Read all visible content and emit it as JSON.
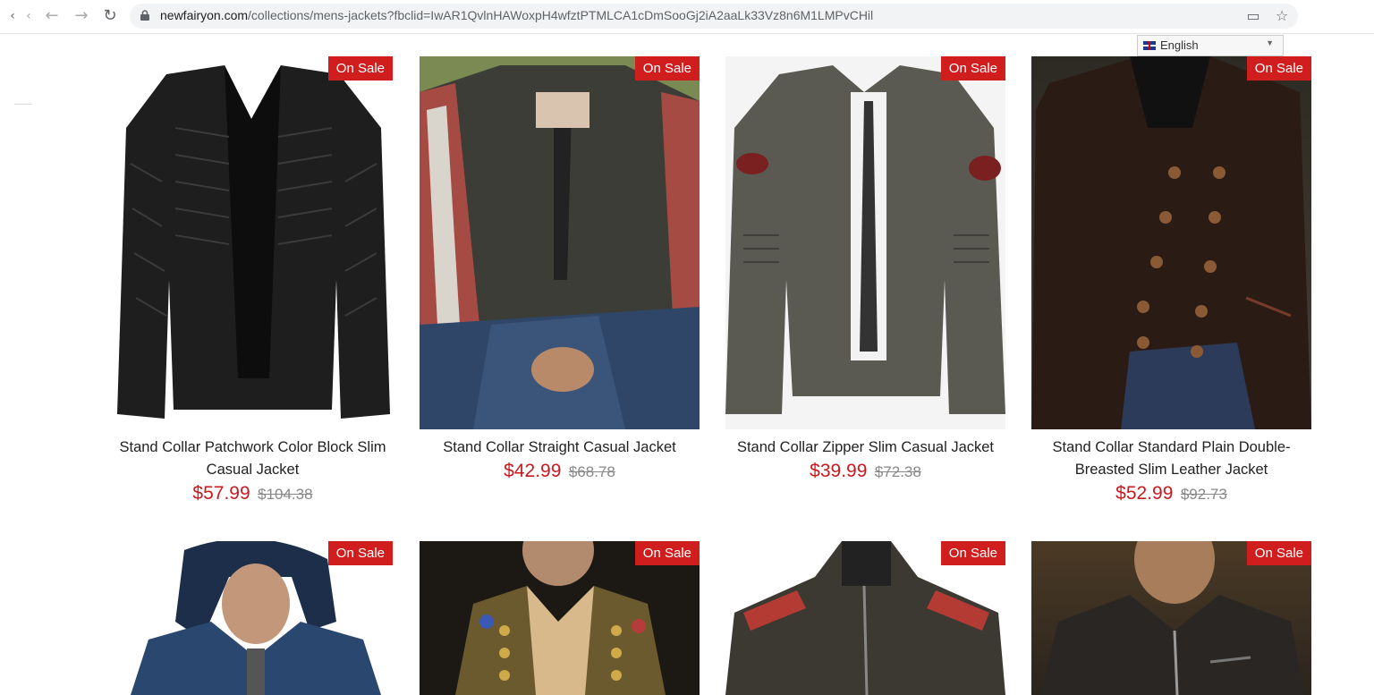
{
  "browser": {
    "url_host": "newfairyon.com",
    "url_path": "/collections/mens-jackets?fbclid=IwAR1QvlnHAWoxpH4wfztPTMLCA1cDmSooGj2iA2aaLk33Vz8n6M1LMPvCHil"
  },
  "language_selector": {
    "value": "English"
  },
  "colors": {
    "sale_badge": "#d01d1d",
    "price": "#c8191f"
  },
  "products": [
    {
      "title": "Stand Collar Patchwork Color Block Slim Casual Jacket",
      "price": "$57.99",
      "old_price": "$104.38",
      "badge": "On Sale"
    },
    {
      "title": "Stand Collar Straight Casual Jacket",
      "price": "$42.99",
      "old_price": "$68.78",
      "badge": "On Sale"
    },
    {
      "title": "Stand Collar Zipper Slim Casual Jacket",
      "price": "$39.99",
      "old_price": "$72.38",
      "badge": "On Sale"
    },
    {
      "title": "Stand Collar Standard Plain Double-Breasted Slim Leather Jacket",
      "price": "$52.99",
      "old_price": "$92.73",
      "badge": "On Sale"
    },
    {
      "badge": "On Sale"
    },
    {
      "badge": "On Sale"
    },
    {
      "badge": "On Sale"
    },
    {
      "badge": "On Sale"
    }
  ]
}
